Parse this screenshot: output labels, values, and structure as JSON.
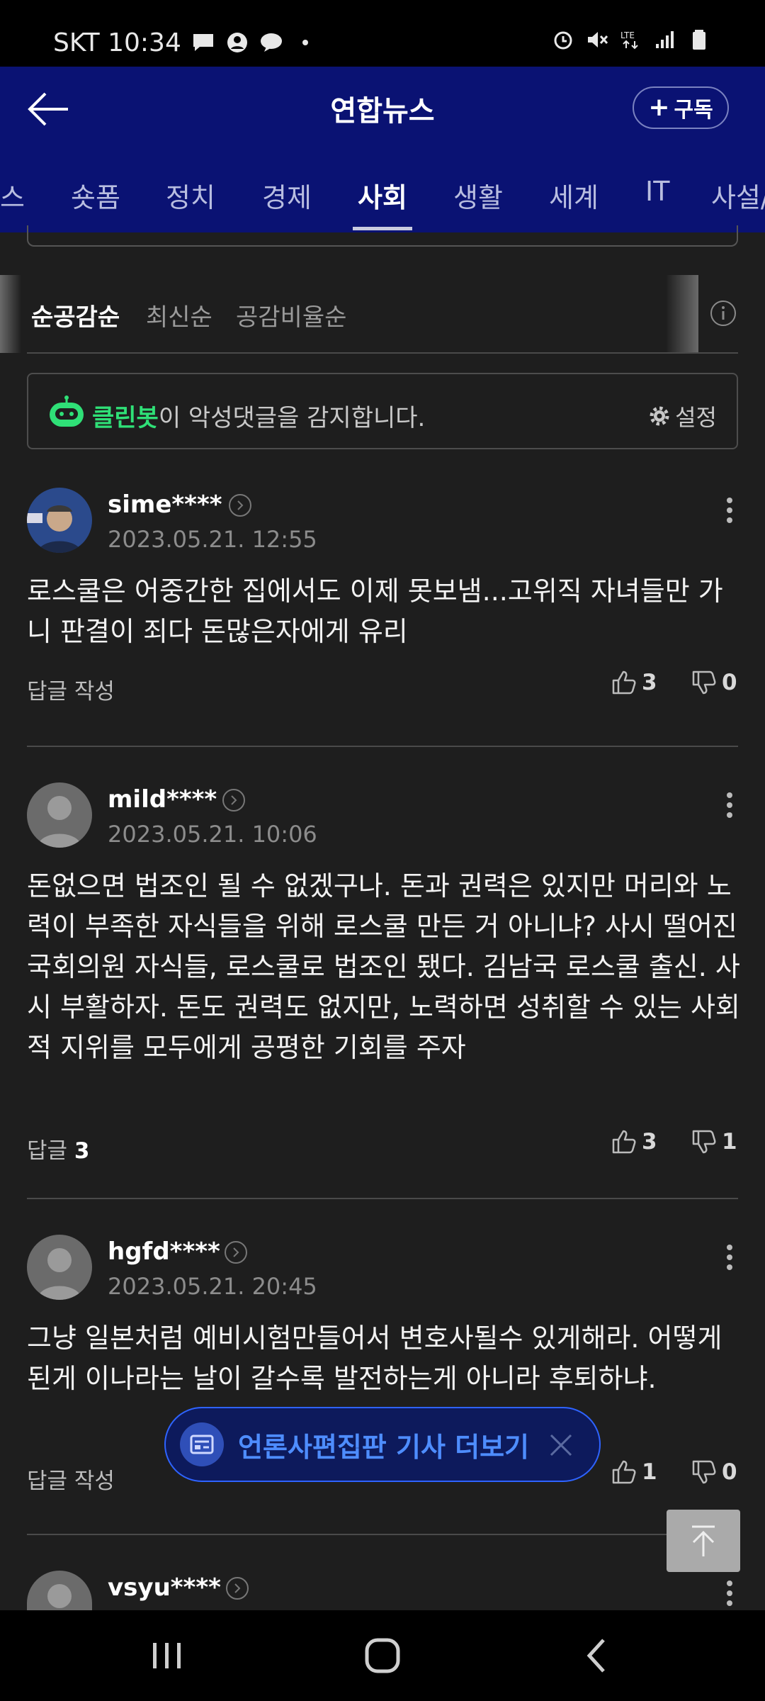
{
  "status_bar": {
    "time": "SKT 10:34"
  },
  "header": {
    "title": "연합뉴스",
    "subscribe_label": "구독"
  },
  "tabs": [
    "스",
    "숏폼",
    "정치",
    "경제",
    "사회",
    "생활",
    "세계",
    "IT",
    "사설/"
  ],
  "active_tab": "사회",
  "sort": {
    "options": [
      "순공감순",
      "최신순",
      "공감비율순"
    ],
    "active": "순공감순"
  },
  "cleanbot": {
    "name": "클린봇",
    "message": "이 악성댓글을 감지합니다.",
    "settings_label": "설정"
  },
  "comments": [
    {
      "username": "sime****",
      "date": "2023.05.21. 12:55",
      "text": "로스쿨은 어중간한 집에서도 이제 못보냄...고위직 자녀들만 가니 판결이 죄다 돈많은자에게 유리",
      "reply_label": "답글 작성",
      "reply_count": "",
      "likes": "3",
      "dislikes": "0"
    },
    {
      "username": "mild****",
      "date": "2023.05.21. 10:06",
      "text": "돈없으면 법조인 될 수 없겠구나. 돈과 권력은 있지만 머리와 노력이 부족한 자식들을 위해 로스쿨 만든 거 아니냐? 사시 떨어진 국회의원 자식들, 로스쿨로 법조인 됐다. 김남국 로스쿨 출신. 사시 부활하자. 돈도 권력도 없지만, 노력하면 성취할 수 있는 사회적 지위를 모두에게 공평한 기회를 주자",
      "reply_label": "답글",
      "reply_count": "3",
      "likes": "3",
      "dislikes": "1"
    },
    {
      "username": "hgfd****",
      "date": "2023.05.21. 20:45",
      "text": "그냥 일본처럼 예비시험만들어서 변호사될수 있게해라. 어떻게 된게 이나라는 날이 갈수록 발전하는게 아니라 후퇴하냐.",
      "reply_label": "답글 작성",
      "reply_count": "",
      "likes": "1",
      "dislikes": "0"
    },
    {
      "username": "vsyu****"
    }
  ],
  "banner": {
    "label": "언론사편집판 기사 더보기"
  },
  "icons": {
    "back": "back-arrow-icon",
    "info": "info-icon",
    "gear": "gear-icon",
    "like": "thumbs-up-icon",
    "dislike": "thumbs-down-icon",
    "more": "kebab-icon",
    "scroll_top": "arrow-up-icon"
  },
  "colors": {
    "header_bg": "#0a1273",
    "accent_green": "#2fe077",
    "banner_blue": "#4e8dff",
    "background": "#1e1e1e"
  }
}
